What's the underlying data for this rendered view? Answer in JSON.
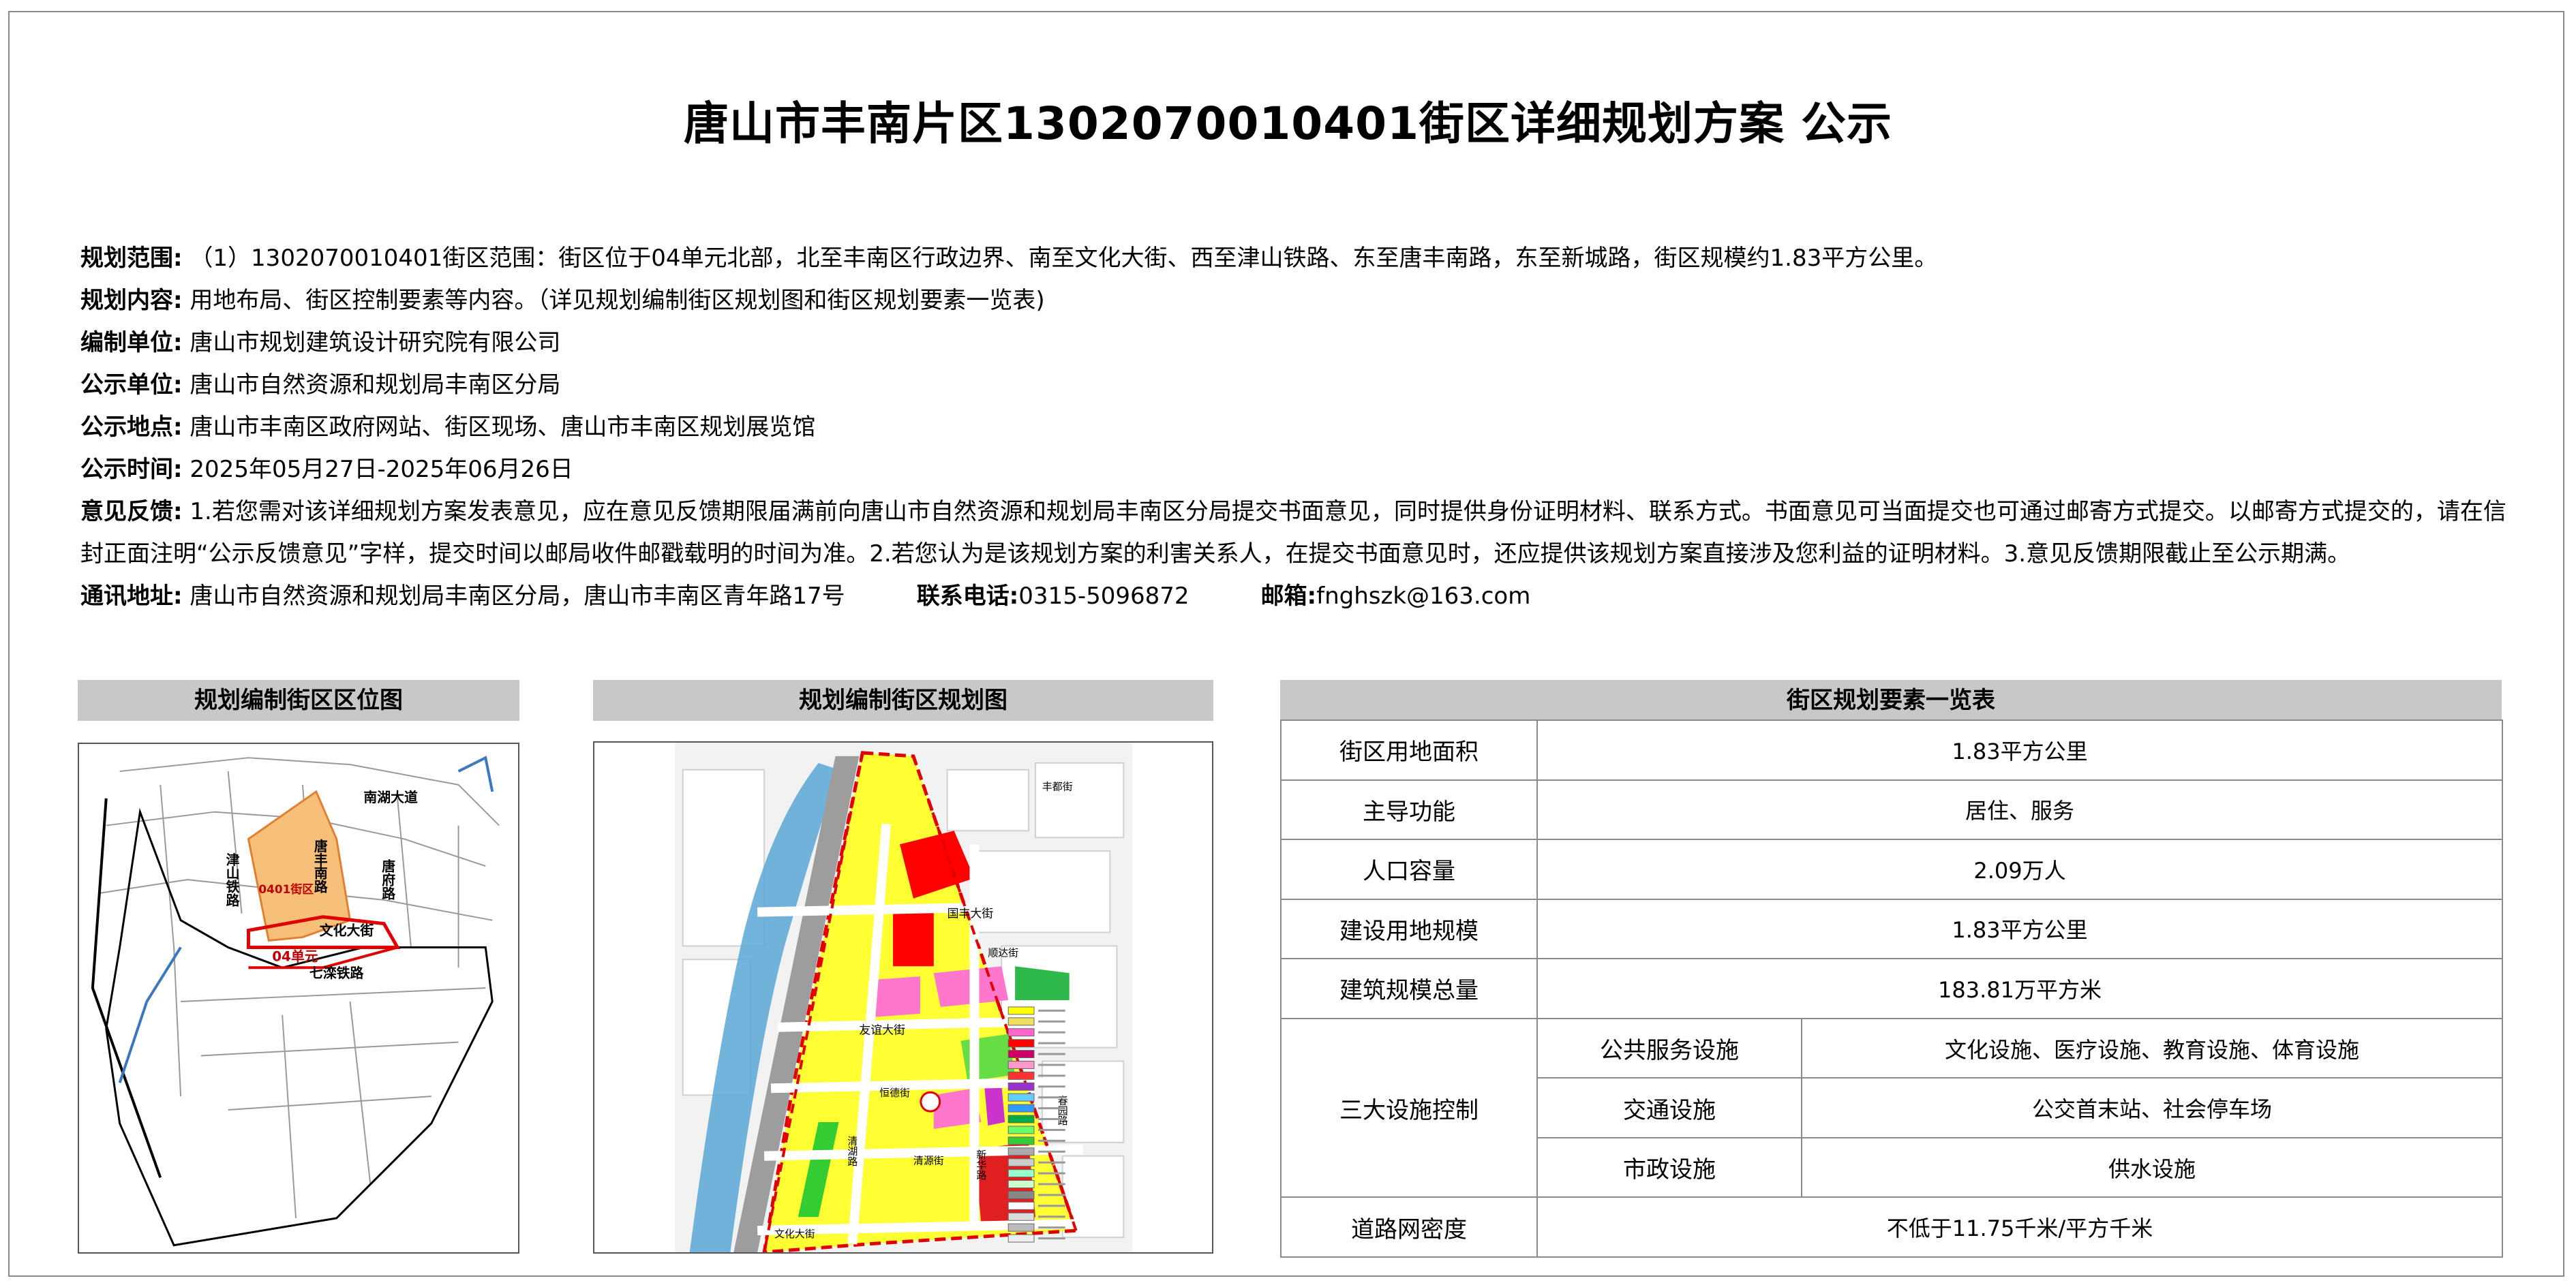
{
  "title": "唐山市丰南片区1302070010401街区详细规划方案 公示",
  "info": {
    "scope_label": "规划范围:",
    "scope_value": "（1）1302070010401街区范围：街区位于04单元北部，北至丰南区行政边界、南至文化大街、西至津山铁路、东至唐丰南路，东至新城路，街区规模约1.83平方公里。",
    "content_label": "规划内容:",
    "content_value": "用地布局、街区控制要素等内容。（详见规划编制街区规划图和街区规划要素一览表)",
    "compiler_label": "编制单位:",
    "compiler_value": "唐山市规划建筑设计研究院有限公司",
    "publisher_label": "公示单位:",
    "publisher_value": "唐山市自然资源和规划局丰南区分局",
    "place_label": "公示地点:",
    "place_value": "唐山市丰南区政府网站、街区现场、唐山市丰南区规划展览馆",
    "time_label": "公示时间:",
    "time_value": "2025年05月27日-2025年06月26日",
    "feedback_label": "意见反馈:",
    "feedback_value": "1.若您需对该详细规划方案发表意见，应在意见反馈期限届满前向唐山市自然资源和规划局丰南区分局提交书面意见，同时提供身份证明材料、联系方式。书面意见可当面提交也可通过邮寄方式提交。以邮寄方式提交的，请在信封正面注明“公示反馈意见”字样，提交时间以邮局收件邮戳载明的时间为准。2.若您认为是该规划方案的利害关系人，在提交书面意见时，还应提供该规划方案直接涉及您利益的证明材料。3.意见反馈期限截止至公示期满。",
    "address_label": "通讯地址:",
    "address_value": "唐山市自然资源和规划局丰南区分局，唐山市丰南区青年路17号",
    "phone_label": "联系电话:",
    "phone_value": "0315-5096872",
    "email_label": "邮箱:",
    "email_value": "fnghszk@163.com"
  },
  "location_map": {
    "header": "规划编制街区区位图",
    "labels": {
      "nanhu": "南湖大道",
      "jinshan": "津山铁路",
      "tangfeng_s": "唐丰南路",
      "tangfu": "唐府路",
      "block": "0401街区",
      "wenhua": "文化大街",
      "unit": "04单元",
      "qizun": "七滦铁路"
    }
  },
  "plan_map": {
    "header": "规划编制街区规划图",
    "labels": {
      "fengbei": "丰都街",
      "guofeng": "国丰大街",
      "shunda": "顺达街",
      "youyi": "友谊大街",
      "hengde": "恒德街",
      "qingyuan": "清源街",
      "qinghu": "清湖路",
      "xinhua": "新华路",
      "wenhua": "文化大街",
      "chuntian": "春园路"
    },
    "legend_colors": [
      "#ffff00",
      "#f0e060",
      "#ff66cc",
      "#ff0000",
      "#cc0066",
      "#ff99cc",
      "#ff3333",
      "#9933cc",
      "#66ccff",
      "#3399ff",
      "#00aa44",
      "#66ff66",
      "#33cc33",
      "#aaaaaa",
      "#cccccc",
      "#99ffcc",
      "#ccffcc",
      "#888888",
      "#ffffff",
      "#dddddd",
      "#bbbbbb",
      "#eeeeee"
    ]
  },
  "table": {
    "header": "街区规划要素一览表",
    "rows": [
      {
        "key": "街区用地面积",
        "value": "1.83平方公里"
      },
      {
        "key": "主导功能",
        "value": "居住、服务"
      },
      {
        "key": "人口容量",
        "value": "2.09万人"
      },
      {
        "key": "建设用地规模",
        "value": "1.83平方公里"
      },
      {
        "key": "建筑规模总量",
        "value": "183.81万平方米"
      }
    ],
    "facilities_key": "三大设施控制",
    "facilities": [
      {
        "key": "公共服务设施",
        "value": "文化设施、医疗设施、教育设施、体育设施"
      },
      {
        "key": "交通设施",
        "value": "公交首末站、社会停车场"
      },
      {
        "key": "市政设施",
        "value": "供水设施"
      }
    ],
    "road_key": "道路网密度",
    "road_value": "不低于11.75千米/平方千米"
  }
}
